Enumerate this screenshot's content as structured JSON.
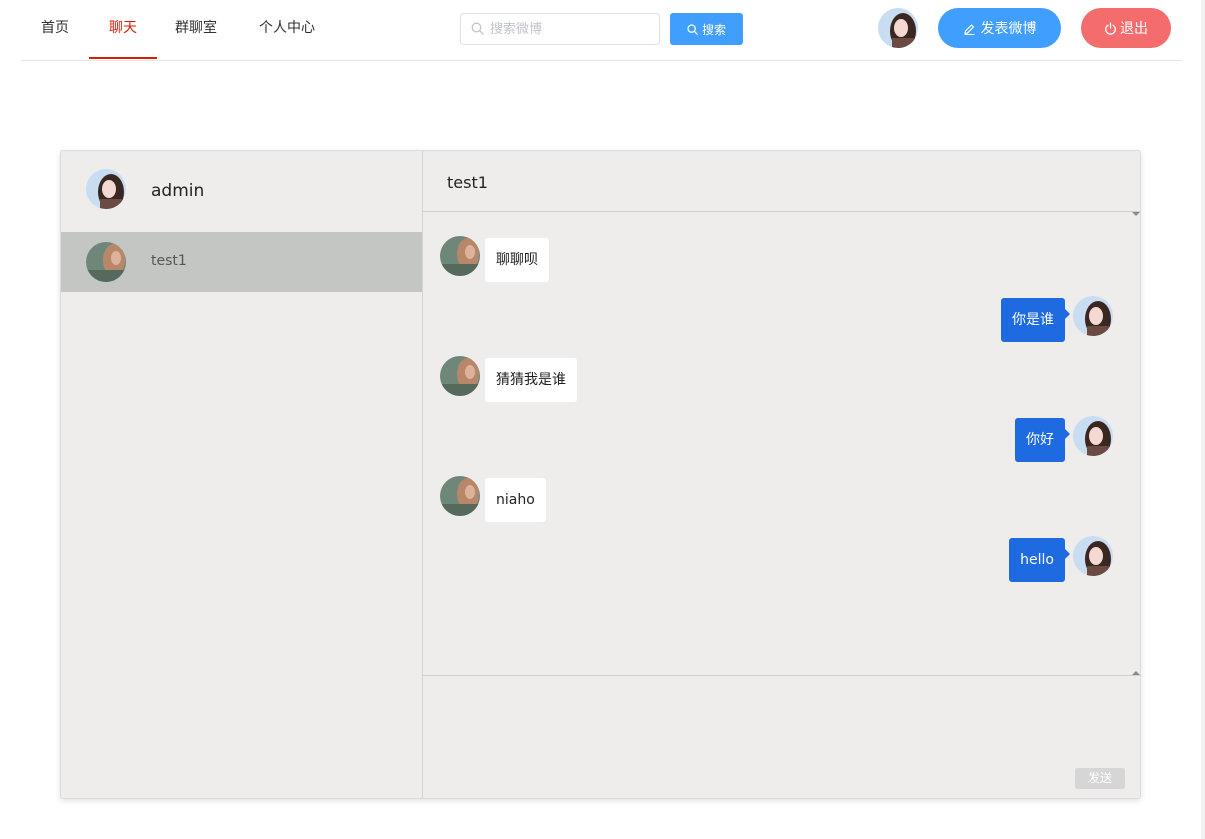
{
  "nav": {
    "tabs": [
      {
        "label": "首页",
        "active": false
      },
      {
        "label": "聊天",
        "active": true
      },
      {
        "label": "群聊室",
        "active": false
      },
      {
        "label": "个人中心",
        "active": false
      }
    ],
    "active_color": "#d81e06",
    "search": {
      "placeholder": "搜索微博",
      "value": "",
      "icon": "search-icon",
      "button_label": "搜索",
      "button_icon": "search-icon"
    },
    "post_button": {
      "label": "发表微博",
      "icon": "pencil-icon",
      "color": "#409eff"
    },
    "logout_button": {
      "label": "退出",
      "icon": "power-icon",
      "color": "#f56c6c"
    },
    "user_avatar": "avatar-female"
  },
  "chat": {
    "current_user": {
      "name": "admin",
      "avatar": "avatar-female"
    },
    "contacts": [
      {
        "name": "test1",
        "avatar": "avatar-test1",
        "selected": true
      }
    ],
    "conversation_title": "test1",
    "messages": [
      {
        "side": "left",
        "text": "聊聊呗"
      },
      {
        "side": "right",
        "text": "你是谁"
      },
      {
        "side": "left",
        "text": "猜猜我是谁"
      },
      {
        "side": "right",
        "text": "你好"
      },
      {
        "side": "left",
        "text": "niaho"
      },
      {
        "side": "right",
        "text": "hello"
      }
    ],
    "input_value": "",
    "send_label": "发送",
    "colors": {
      "outgoing_bubble": "#1e6be1",
      "incoming_bubble": "#ffffff",
      "panel_bg": "#efecec",
      "selected_contact": "#c4c6c4"
    }
  }
}
